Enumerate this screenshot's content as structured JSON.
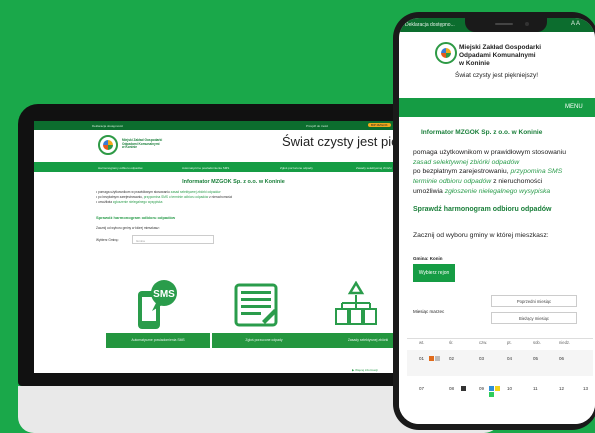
{
  "laptop": {
    "topbar": {
      "left": "Deklaracja dostępności",
      "middle": "Przejdź do treści",
      "right": "BIP MZGOK"
    },
    "org_name": [
      "Miejski Zakład Gospodarki",
      "Odpadami Komunalnymi",
      "w Koninie"
    ],
    "slogan": "Świat czysty jest piękniejszy!",
    "nav": [
      "Harmonogramy odbioru odpadów",
      "Automatyczne powiadomienia SMS",
      "Zgłoś porzucone odpady",
      "Zasady selektywnej zbiórki"
    ],
    "title": "Informator MZGOK Sp. z o.o. w Koninie",
    "list": [
      {
        "text": "pomaga użytkownikom w prawidłowym stosowaniu ",
        "link": "zasad selektywnej zbiórki odpadów"
      },
      {
        "text": "po bezpłatnym zarejestrowaniu, ",
        "link": "przypomina SMS o terminie odbioru odpadów",
        "text2": " z nieruchomości"
      },
      {
        "text": "umożliwia ",
        "link": "zgłoszenie nielegalnego wysypiska"
      }
    ],
    "subheading": "Sprawdź harmonogram odbioru odpadów",
    "choose_text": "Zacznij od wyboru gminy w której mieszkasz:",
    "select_label": "Wybierz Gminę:",
    "select_placeholder": "Gmina",
    "cards": [
      {
        "icon": "sms-icon",
        "icon_text": "SMS",
        "label": "Automatyczne powiadomienia SMS"
      },
      {
        "icon": "report-icon",
        "label": "Zgłoś porzucone odpady"
      },
      {
        "icon": "recycle-bins-icon",
        "label": "Zasady selektywnej zbiórki"
      }
    ],
    "footer_link": "Więcej informacji"
  },
  "phone": {
    "status_left": "Deklaracja dostępno...",
    "org_name": [
      "Miejski Zakład Gospodarki",
      "Odpadami Komunalnymi",
      "w Koninie"
    ],
    "slogan": "Świat czysty jest piękniejszy!",
    "menu_label": "MENU",
    "title": "Informator MZGOK Sp. z o.o. w Koninie",
    "lines": [
      {
        "text": "pomaga użytkownikom w prawidłowym stosowaniu"
      },
      {
        "link": "zasad selektywnej zbiórki odpadów"
      },
      {
        "text": "po bezpłatnym zarejestrowaniu, ",
        "link": "przypomina SMS"
      },
      {
        "link": "terminie odbioru odpadów",
        "text": " z nieruchomości"
      },
      {
        "text": "umożliwia ",
        "link": "zgłoszenie nielegalnego wysypiska"
      }
    ],
    "subheading": "Sprawdź harmonogram odbioru odpadów",
    "choose_text": "Zacznij od wyboru gminy w której mieszkasz:",
    "gmina_label": "Gmina: Konin",
    "region_button": "Wybierz rejon",
    "prev_month": "Poprzedni miesiąc",
    "this_month": "Bieżący miesiąc",
    "month_label": "Miesiąc marzec",
    "weekdays": [
      "pon.",
      "wt.",
      "śr.",
      "czw.",
      "pt.",
      "sob.",
      "niedz."
    ],
    "week1": [
      "",
      "01",
      "02",
      "03",
      "04",
      "05",
      "06"
    ],
    "week2": [
      "",
      "07",
      "08",
      "09",
      "10",
      "11",
      "12",
      "13"
    ]
  },
  "colors": {
    "brand_green": "#159c44",
    "dark_green": "#0c6d2e",
    "background": "#1aa84a"
  }
}
